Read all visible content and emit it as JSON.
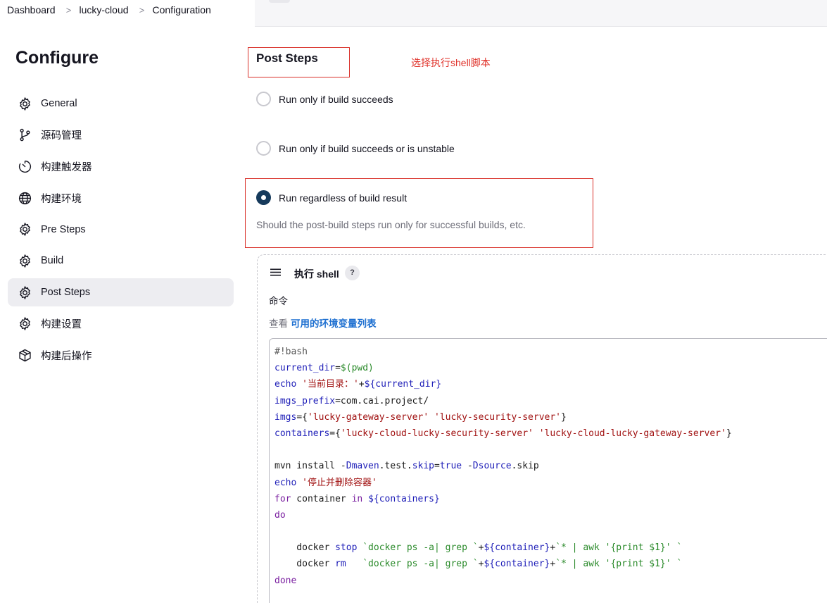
{
  "breadcrumb": {
    "items": [
      "Dashboard",
      "lucky-cloud",
      "Configuration"
    ],
    "separator": ">"
  },
  "sidebar": {
    "title": "Configure",
    "items": [
      {
        "label": "General",
        "icon": "gear-icon",
        "active": false
      },
      {
        "label": "源码管理",
        "icon": "git-branch-icon",
        "active": false
      },
      {
        "label": "构建触发器",
        "icon": "timer-icon",
        "active": false
      },
      {
        "label": "构建环境",
        "icon": "globe-icon",
        "active": false
      },
      {
        "label": "Pre Steps",
        "icon": "gear-icon",
        "active": false
      },
      {
        "label": "Build",
        "icon": "gear-icon",
        "active": false
      },
      {
        "label": "Post Steps",
        "icon": "gear-icon",
        "active": true
      },
      {
        "label": "构建设置",
        "icon": "gear-icon",
        "active": false
      },
      {
        "label": "构建后操作",
        "icon": "package-icon",
        "active": false
      }
    ]
  },
  "post_steps": {
    "title": "Post Steps",
    "annotation": "选择执行shell脚本",
    "options": [
      {
        "label": "Run only if build succeeds",
        "checked": false
      },
      {
        "label": "Run only if build succeeds or is unstable",
        "checked": false
      },
      {
        "label": "Run regardless of build result",
        "checked": true
      }
    ],
    "help_text": "Should the post-build steps run only for successful builds, etc."
  },
  "shell_step": {
    "title": "执行 shell",
    "help_label": "?",
    "command_label": "命令",
    "see_prefix": "查看",
    "env_link": "可用的环境变量列表",
    "code_lines": [
      [
        {
          "t": "#!bash",
          "c": "comment"
        }
      ],
      [
        {
          "t": "current_dir",
          "c": "var"
        },
        {
          "t": "=",
          "c": "op"
        },
        {
          "t": "$(pwd)",
          "c": "gstr"
        }
      ],
      [
        {
          "t": "echo",
          "c": "var"
        },
        {
          "t": " ",
          "c": "op"
        },
        {
          "t": "'当前目录：'",
          "c": "str"
        },
        {
          "t": "+",
          "c": "op"
        },
        {
          "t": "${current_dir}",
          "c": "var"
        }
      ],
      [
        {
          "t": "imgs_prefix",
          "c": "var"
        },
        {
          "t": "=com.cai.project/",
          "c": "op"
        }
      ],
      [
        {
          "t": "imgs",
          "c": "var"
        },
        {
          "t": "={",
          "c": "op"
        },
        {
          "t": "'lucky-gateway-server'",
          "c": "str"
        },
        {
          "t": " ",
          "c": "op"
        },
        {
          "t": "'lucky-security-server'",
          "c": "str"
        },
        {
          "t": "}",
          "c": "op"
        }
      ],
      [
        {
          "t": "containers",
          "c": "var"
        },
        {
          "t": "={",
          "c": "op"
        },
        {
          "t": "'lucky-cloud-lucky-security-server'",
          "c": "str"
        },
        {
          "t": " ",
          "c": "op"
        },
        {
          "t": "'lucky-cloud-lucky-gateway-server'",
          "c": "str"
        },
        {
          "t": "}",
          "c": "op"
        }
      ],
      [
        {
          "t": "",
          "c": "op"
        }
      ],
      [
        {
          "t": "mvn install -",
          "c": "op"
        },
        {
          "t": "Dmaven",
          "c": "var"
        },
        {
          "t": ".test.",
          "c": "op"
        },
        {
          "t": "skip",
          "c": "var"
        },
        {
          "t": "=",
          "c": "op"
        },
        {
          "t": "true",
          "c": "var"
        },
        {
          "t": " -",
          "c": "op"
        },
        {
          "t": "Dsource",
          "c": "var"
        },
        {
          "t": ".skip",
          "c": "op"
        }
      ],
      [
        {
          "t": "echo",
          "c": "var"
        },
        {
          "t": " ",
          "c": "op"
        },
        {
          "t": "'停止并删除容器'",
          "c": "str"
        }
      ],
      [
        {
          "t": "for",
          "c": "kw"
        },
        {
          "t": " container ",
          "c": "op"
        },
        {
          "t": "in",
          "c": "kw"
        },
        {
          "t": " ",
          "c": "op"
        },
        {
          "t": "${containers}",
          "c": "var"
        }
      ],
      [
        {
          "t": "do",
          "c": "kw"
        }
      ],
      [
        {
          "t": "",
          "c": "op"
        }
      ],
      [
        {
          "t": "    docker ",
          "c": "op"
        },
        {
          "t": "stop",
          "c": "var"
        },
        {
          "t": " ",
          "c": "op"
        },
        {
          "t": "`docker ps -a| grep `",
          "c": "gstr"
        },
        {
          "t": "+",
          "c": "op"
        },
        {
          "t": "${container}",
          "c": "var"
        },
        {
          "t": "+",
          "c": "op"
        },
        {
          "t": "`* | awk '{print $1}' `",
          "c": "gstr"
        }
      ],
      [
        {
          "t": "    docker ",
          "c": "op"
        },
        {
          "t": "rm",
          "c": "var"
        },
        {
          "t": "   ",
          "c": "op"
        },
        {
          "t": "`docker ps -a| grep `",
          "c": "gstr"
        },
        {
          "t": "+",
          "c": "op"
        },
        {
          "t": "${container}",
          "c": "var"
        },
        {
          "t": "+",
          "c": "op"
        },
        {
          "t": "`* | awk '{print $1}' `",
          "c": "gstr"
        }
      ],
      [
        {
          "t": "done",
          "c": "kw"
        }
      ]
    ]
  },
  "colors": {
    "accent": "#163a5c",
    "annotation_red": "#d9312a",
    "link_blue": "#1d6fd0"
  }
}
